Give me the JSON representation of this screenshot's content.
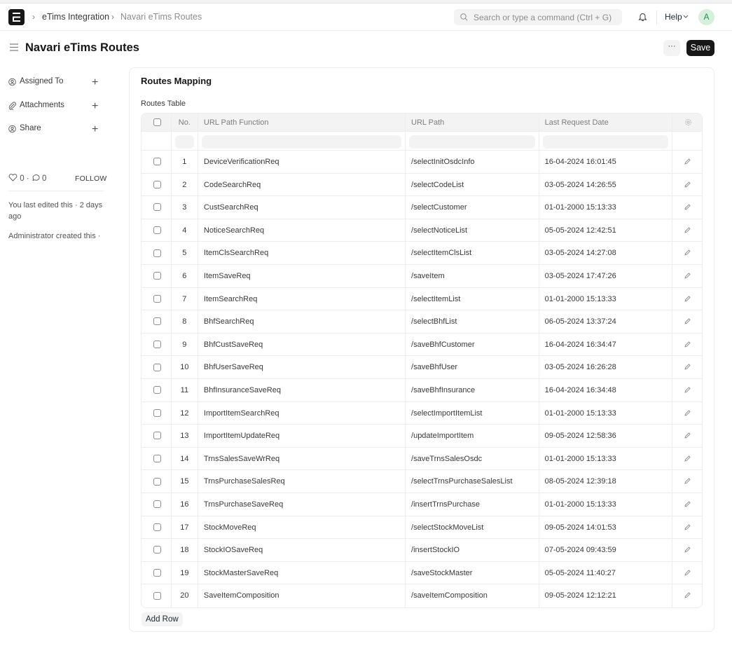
{
  "navbar": {
    "breadcrumbs": [
      "eTims Integration",
      "Navari eTims Routes"
    ],
    "search_placeholder": "Search or type a command (Ctrl + G)",
    "help_label": "Help",
    "avatar_initial": "A"
  },
  "header": {
    "title": "Navari eTims Routes",
    "more_label": "···",
    "save_label": "Save"
  },
  "sidebar": {
    "items": [
      {
        "label": "Assigned To"
      },
      {
        "label": "Attachments"
      },
      {
        "label": "Share"
      }
    ],
    "likes_count": "0",
    "comments_count": "0",
    "follow_label": "FOLLOW",
    "last_edited": "You last edited this · 2 days ago",
    "created_by": "Administrator created this ·"
  },
  "main": {
    "section_title": "Routes Mapping",
    "table_label": "Routes Table",
    "columns": [
      "No.",
      "URL Path Function",
      "URL Path",
      "Last Request Date"
    ],
    "rows": [
      {
        "no": "1",
        "function": "DeviceVerificationReq",
        "path": "/selectInitOsdcInfo",
        "date": "16-04-2024 16:01:45"
      },
      {
        "no": "2",
        "function": "CodeSearchReq",
        "path": "/selectCodeList",
        "date": "03-05-2024 14:26:55"
      },
      {
        "no": "3",
        "function": "CustSearchReq",
        "path": "/selectCustomer",
        "date": "01-01-2000 15:13:33"
      },
      {
        "no": "4",
        "function": "NoticeSearchReq",
        "path": "/selectNoticeList",
        "date": "05-05-2024 12:42:51"
      },
      {
        "no": "5",
        "function": "ItemClsSearchReq",
        "path": "/selectItemClsList",
        "date": "03-05-2024 14:27:08"
      },
      {
        "no": "6",
        "function": "ItemSaveReq",
        "path": "/saveItem",
        "date": "03-05-2024 17:47:26"
      },
      {
        "no": "7",
        "function": "ItemSearchReq",
        "path": "/selectItemList",
        "date": "01-01-2000 15:13:33"
      },
      {
        "no": "8",
        "function": "BhfSearchReq",
        "path": "/selectBhfList",
        "date": "06-05-2024 13:37:24"
      },
      {
        "no": "9",
        "function": "BhfCustSaveReq",
        "path": "/saveBhfCustomer",
        "date": "16-04-2024 16:34:47"
      },
      {
        "no": "10",
        "function": "BhfUserSaveReq",
        "path": "/saveBhfUser",
        "date": "03-05-2024 16:26:28"
      },
      {
        "no": "11",
        "function": "BhfInsuranceSaveReq",
        "path": "/saveBhfInsurance",
        "date": "16-04-2024 16:34:48"
      },
      {
        "no": "12",
        "function": "ImportItemSearchReq",
        "path": "/selectImportItemList",
        "date": "01-01-2000 15:13:33"
      },
      {
        "no": "13",
        "function": "ImportItemUpdateReq",
        "path": "/updateImportItem",
        "date": "09-05-2024 12:58:36"
      },
      {
        "no": "14",
        "function": "TrnsSalesSaveWrReq",
        "path": "/saveTrnsSalesOsdc",
        "date": "01-01-2000 15:13:33"
      },
      {
        "no": "15",
        "function": "TrnsPurchaseSalesReq",
        "path": "/selectTrnsPurchaseSalesList",
        "date": "08-05-2024 12:39:18"
      },
      {
        "no": "16",
        "function": "TrnsPurchaseSaveReq",
        "path": "/insertTrnsPurchase",
        "date": "01-01-2000 15:13:33"
      },
      {
        "no": "17",
        "function": "StockMoveReq",
        "path": "/selectStockMoveList",
        "date": "09-05-2024 14:01:53"
      },
      {
        "no": "18",
        "function": "StockIOSaveReq",
        "path": "/insertStockIO",
        "date": "07-05-2024 09:43:59"
      },
      {
        "no": "19",
        "function": "StockMasterSaveReq",
        "path": "/saveStockMaster",
        "date": "05-05-2024 11:40:27"
      },
      {
        "no": "20",
        "function": "SaveItemComposition",
        "path": "/saveItemComposition",
        "date": "09-05-2024 12:12:21"
      }
    ],
    "add_row_label": "Add Row"
  }
}
